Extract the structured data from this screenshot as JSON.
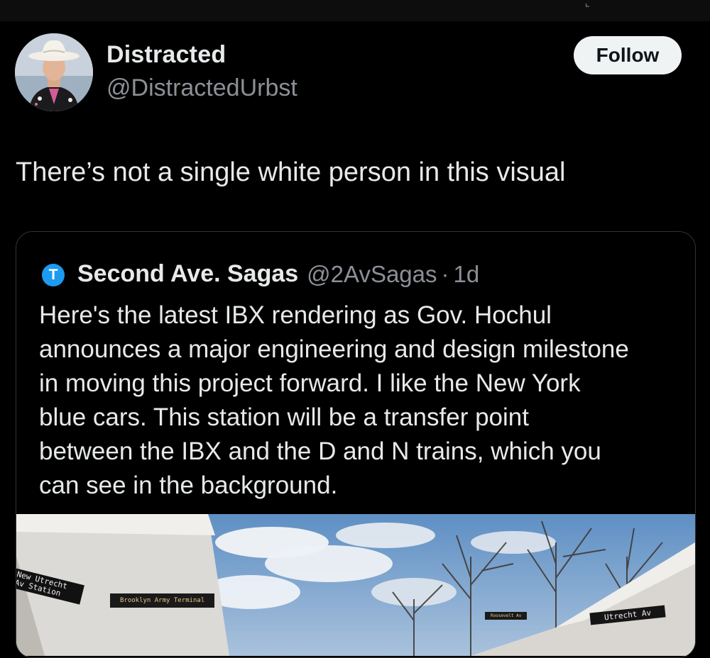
{
  "author": {
    "name": "Distracted",
    "handle": "@DistractedUrbst",
    "follow_label": "Follow"
  },
  "tweet": {
    "text": "There’s not a single white person in this visual"
  },
  "quoted": {
    "avatar_letter": "T",
    "name": "Second Ave. Sagas",
    "handle": "@2AvSagas",
    "separator": "·",
    "time": "1d",
    "lines": [
      "Here's the latest IBX rendering as Gov. Hochul",
      "announces a major engineering and design milestone",
      "in moving this project forward. I like the New York",
      "blue cars. This station will be a transfer point",
      "between the IBX and the D and N trains, which you",
      "can see in the background."
    ],
    "media": {
      "sign_left": "New Utrecht Av Station",
      "sign_center": "Brooklyn Army Terminal",
      "sign_right_small": "Roosevelt Av",
      "sign_right": "Utrecht Av"
    }
  },
  "colors": {
    "background": "#000000",
    "text": "#e7e9ea",
    "secondary_text": "#8b9096",
    "follow_bg": "#eff3f4",
    "quote_avatar": "#1d9bf0"
  }
}
